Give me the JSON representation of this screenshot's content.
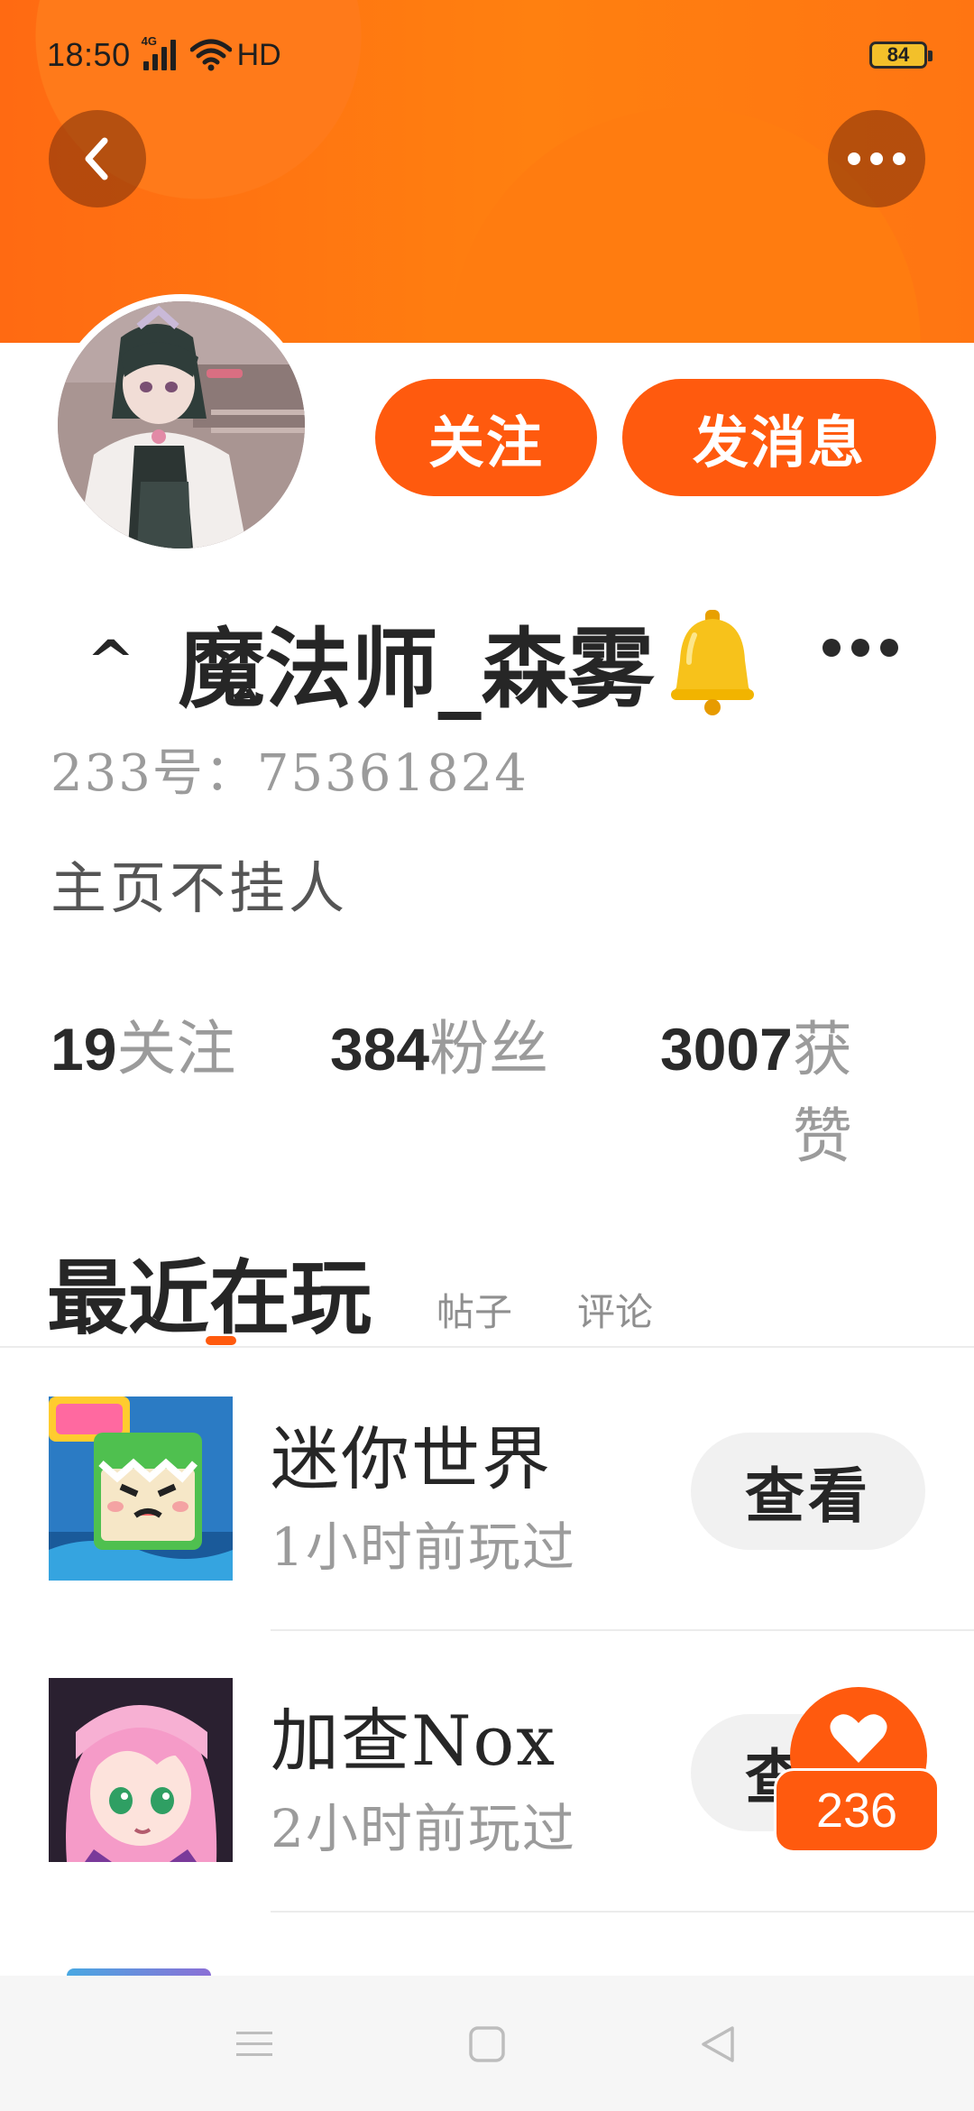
{
  "status_bar": {
    "time": "18:50",
    "network": "4G",
    "hd": "HD",
    "battery": "84"
  },
  "profile": {
    "follow_label": "关注",
    "message_label": "发消息",
    "name_prefix": "^",
    "username": "魔法师_森雾",
    "id_label": "233号：",
    "id_value": "75361824",
    "bio": "主页不挂人"
  },
  "stats": [
    {
      "value": "19",
      "label": "关注"
    },
    {
      "value": "384",
      "label": "粉丝"
    },
    {
      "value": "3007",
      "label": "获赞"
    }
  ],
  "tabs": {
    "active": "最近在玩",
    "posts": "帖子",
    "comments": "评论"
  },
  "games": [
    {
      "name": "迷你世界",
      "played": "1小时前玩过",
      "action": "查看"
    },
    {
      "name": "加查Nox",
      "played": "2小时前玩过",
      "action": "查看"
    }
  ],
  "like_fab": {
    "count": "236"
  },
  "icons": {
    "back": "chevron-left-icon",
    "more": "more-horizontal-icon",
    "bell": "bell-emoji-icon",
    "like": "heart-icon"
  },
  "colors": {
    "brand": "#ff5a0e",
    "header": "#ff7a12"
  }
}
